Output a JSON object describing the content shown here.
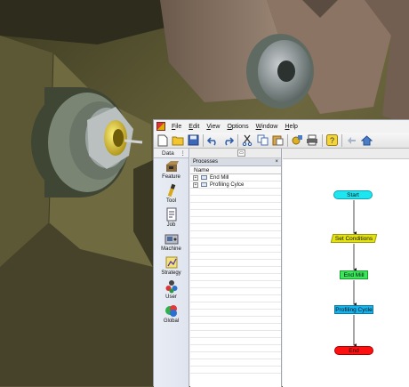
{
  "scene": {
    "description_icon": "cnc-machine-3d-view-icon"
  },
  "window": {
    "icon": "app-logo-icon",
    "menus": [
      {
        "label": "File",
        "mnemonic": "F"
      },
      {
        "label": "Edit",
        "mnemonic": "E"
      },
      {
        "label": "View",
        "mnemonic": "V"
      },
      {
        "label": "Options",
        "mnemonic": "O"
      },
      {
        "label": "Window",
        "mnemonic": "W"
      },
      {
        "label": "Help",
        "mnemonic": "H"
      }
    ]
  },
  "toolbar": {
    "icons": [
      "new-icon",
      "open-folder-icon",
      "save-icon",
      "undo-icon",
      "redo-icon",
      "cut-icon",
      "copy-icon",
      "paste-icon",
      "run-icon",
      "print-icon",
      "help-icon",
      "back-icon",
      "home-icon"
    ]
  },
  "palette": {
    "title": "Data",
    "pin": "⋮",
    "items": [
      {
        "label": "Feature",
        "icon": "feature-icon"
      },
      {
        "label": "Tool",
        "icon": "tool-icon"
      },
      {
        "label": "Job",
        "icon": "job-icon"
      },
      {
        "label": "Machine",
        "icon": "machine-icon"
      },
      {
        "label": "Strategy",
        "icon": "strategy-icon"
      },
      {
        "label": "User",
        "icon": "user-icon"
      },
      {
        "label": "Global",
        "icon": "global-icon"
      }
    ]
  },
  "processes": {
    "title": "Processes",
    "close": "×",
    "column": "Name",
    "expand_glyph": "+",
    "rows": [
      "End Mill",
      "Profiling Cylce"
    ]
  },
  "flowchart": {
    "nodes": [
      "Start",
      "Set Conditions",
      "End Mill",
      "Profiling Cycle",
      "End"
    ],
    "colors": {
      "start": "#1ee6f0",
      "conditions": "#e4e20e",
      "end_mill": "#38e85a",
      "profiling": "#15b4ef",
      "end": "#ff1010"
    }
  }
}
